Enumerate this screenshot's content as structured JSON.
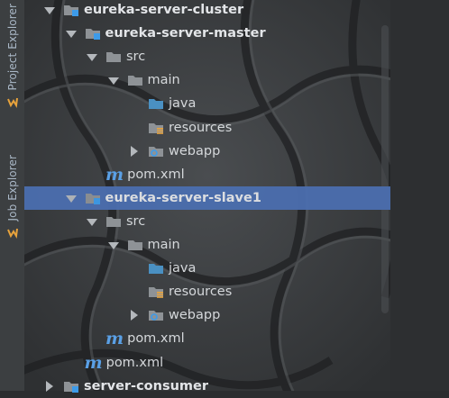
{
  "side_tabs": [
    {
      "label": "Project Explorer",
      "icon": "project-explorer-icon"
    },
    {
      "label": "Job Explorer",
      "icon": "job-explorer-icon"
    }
  ],
  "tree": [
    {
      "label": "eureka-server-cluster",
      "arrow": "down",
      "icon": "module-folder-icon",
      "bold": true,
      "indent": 0
    },
    {
      "label": "eureka-server-master",
      "arrow": "down",
      "icon": "module-folder-icon",
      "bold": true,
      "indent": 1
    },
    {
      "label": "src",
      "arrow": "down",
      "icon": "folder-icon",
      "bold": false,
      "indent": 2
    },
    {
      "label": "main",
      "arrow": "down",
      "icon": "folder-icon",
      "bold": false,
      "indent": 3
    },
    {
      "label": "java",
      "arrow": "none",
      "icon": "source-folder-icon",
      "bold": false,
      "indent": 4
    },
    {
      "label": "resources",
      "arrow": "none",
      "icon": "resources-folder-icon",
      "bold": false,
      "indent": 4
    },
    {
      "label": "webapp",
      "arrow": "right",
      "icon": "web-folder-icon",
      "bold": false,
      "indent": 4
    },
    {
      "label": "pom.xml",
      "arrow": "none",
      "icon": "maven-icon",
      "bold": false,
      "indent": 2
    },
    {
      "label": "eureka-server-slave1",
      "arrow": "down",
      "icon": "module-folder-icon",
      "bold": true,
      "indent": 1,
      "selected": true
    },
    {
      "label": "src",
      "arrow": "down",
      "icon": "folder-icon",
      "bold": false,
      "indent": 2
    },
    {
      "label": "main",
      "arrow": "down",
      "icon": "folder-icon",
      "bold": false,
      "indent": 3
    },
    {
      "label": "java",
      "arrow": "none",
      "icon": "source-folder-icon",
      "bold": false,
      "indent": 4
    },
    {
      "label": "resources",
      "arrow": "none",
      "icon": "resources-folder-icon",
      "bold": false,
      "indent": 4
    },
    {
      "label": "webapp",
      "arrow": "right",
      "icon": "web-folder-icon",
      "bold": false,
      "indent": 4
    },
    {
      "label": "pom.xml",
      "arrow": "none",
      "icon": "maven-icon",
      "bold": false,
      "indent": 2
    },
    {
      "label": "pom.xml",
      "arrow": "none",
      "icon": "maven-icon",
      "bold": false,
      "indent": 1
    },
    {
      "label": "server-consumer",
      "arrow": "right",
      "icon": "module-folder-icon",
      "bold": true,
      "indent": 0
    }
  ],
  "colors": {
    "selection": "#4b6eaf",
    "folder": "#8e9296",
    "source_folder": "#4a90c2",
    "module_badge": "#3d9be9",
    "maven": "#5aa0e6",
    "tab_icon": "#e8a33c"
  }
}
